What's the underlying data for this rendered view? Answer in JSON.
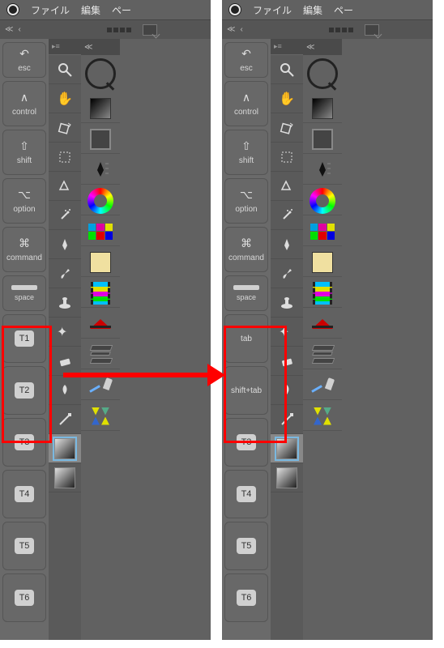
{
  "menubar": {
    "file": "ファイル",
    "edit": "編集",
    "page": "ペー"
  },
  "left": {
    "keys": {
      "esc": "esc",
      "control": "control",
      "shift": "shift",
      "option": "option",
      "command": "command",
      "space": "space",
      "t1": "T1",
      "t2": "T2",
      "t3": "T3",
      "t4": "T4",
      "t5": "T5",
      "t6": "T6"
    }
  },
  "right": {
    "keys": {
      "esc": "esc",
      "control": "control",
      "shift": "shift",
      "option": "option",
      "command": "command",
      "space": "space",
      "tab": "tab",
      "shifttab": "shift+tab",
      "t3": "T3",
      "t4": "T4",
      "t5": "T5",
      "t6": "T6"
    }
  },
  "tooltips": {
    "magnify": "magnify",
    "hand": "hand",
    "rotateview": "rotate-view",
    "select": "select",
    "lasso": "lasso",
    "magicwand": "magic-wand",
    "pen": "pen",
    "brush": "brush",
    "stamp": "stamp",
    "sparkle": "sparkle",
    "eraser": "eraser",
    "liquify": "liquify",
    "line": "line",
    "bucket": "bucket",
    "gradient": "gradient"
  }
}
